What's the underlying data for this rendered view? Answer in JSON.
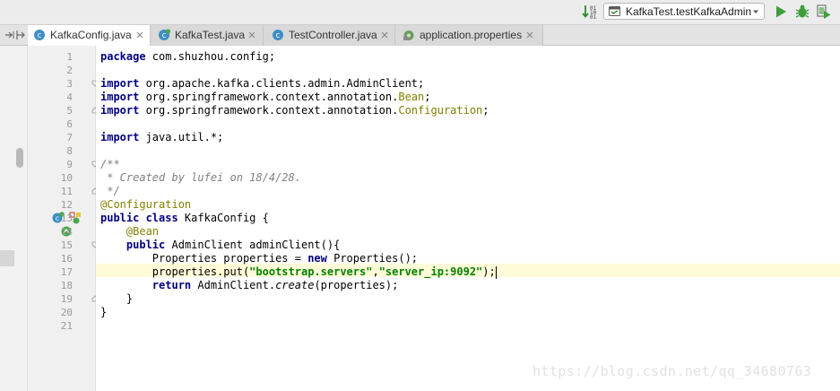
{
  "toolbar": {
    "run_config_label": "KafkaTest.testKafkaAdmin",
    "sort_icon": "sort-numeric-icon",
    "run_icon": "run-icon",
    "debug_icon": "debug-icon",
    "coverage_icon": "coverage-icon"
  },
  "tabs": [
    {
      "label": "KafkaConfig.java",
      "icon": "java-class-icon",
      "active": true
    },
    {
      "label": "KafkaTest.java",
      "icon": "java-test-icon",
      "active": false
    },
    {
      "label": "TestController.java",
      "icon": "java-class-icon",
      "active": false
    },
    {
      "label": "application.properties",
      "icon": "properties-icon",
      "active": false
    }
  ],
  "gutter": {
    "line_numbers": [
      "1",
      "2",
      "3",
      "4",
      "5",
      "6",
      "7",
      "8",
      "9",
      "10",
      "11",
      "12",
      "13",
      "14",
      "15",
      "16",
      "17",
      "18",
      "19",
      "20",
      "21"
    ]
  },
  "code": {
    "l1": {
      "kw": "package",
      "rest": " com.shuzhou.config;"
    },
    "l3": {
      "kw": "import",
      "rest": " org.apache.kafka.clients.admin.AdminClient;"
    },
    "l4": {
      "kw": "import",
      "rest": " org.springframework.context.annotation.",
      "ann": "Bean",
      "end": ";"
    },
    "l5": {
      "kw": "import",
      "rest": " org.springframework.context.annotation.",
      "ann": "Configuration",
      "end": ";"
    },
    "l7": {
      "kw": "import",
      "rest": " java.util.*;"
    },
    "l9": {
      "cmt": "/**"
    },
    "l10": {
      "cmt": " * Created by lufei on 18/4/28."
    },
    "l11": {
      "cmt": " */"
    },
    "l12": {
      "ann": "@Configuration"
    },
    "l13": {
      "kw": "public class",
      "rest": " KafkaConfig {"
    },
    "l14": {
      "indent": "    ",
      "ann": "@Bean"
    },
    "l15": {
      "indent": "    ",
      "kw": "public",
      "rest": " AdminClient adminClient(){"
    },
    "l16": {
      "indent": "        ",
      "pre": "Properties properties = ",
      "kw": "new",
      "rest": " Properties();"
    },
    "l17": {
      "indent": "        ",
      "pre": "properties.put(",
      "s1": "\"bootstrap.servers\"",
      "comma": ",",
      "s2": "\"server_ip:9092\"",
      "end": ");"
    },
    "l18": {
      "indent": "        ",
      "kw": "return",
      "pre": " AdminClient.",
      "it": "create",
      "rest": "(properties);"
    },
    "l19": {
      "text": "    }"
    },
    "l20": {
      "text": "}"
    }
  },
  "watermark": "https://blog.csdn.net/qq_34680763"
}
